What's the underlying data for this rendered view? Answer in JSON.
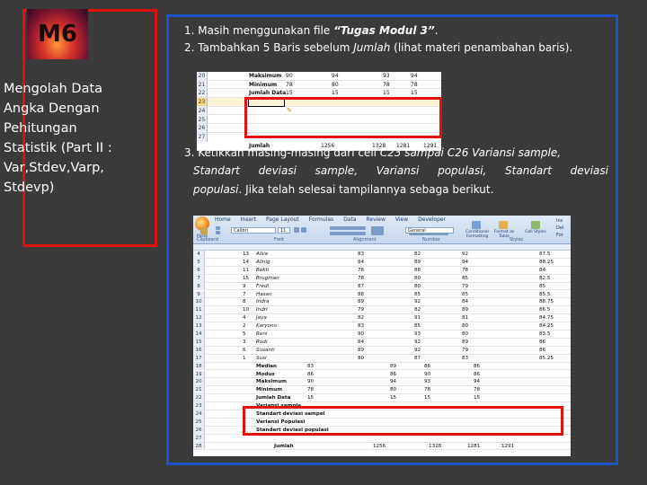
{
  "left": {
    "badge": "M6",
    "title_lines": [
      "Mengolah Data",
      "Angka Dengan",
      "Pehitungan",
      "Statistik (Part II :",
      "Var,Stdev,Varp,",
      "Stdevp)"
    ]
  },
  "steps": {
    "s1_num": "1.",
    "s1_a": "Masih menggunakan file ",
    "s1_b": "“Tugas Modul 3”",
    "s1_c": ".",
    "s2_num": "2.",
    "s2_a": "Tambahkan 5 Baris sebelum ",
    "s2_b": "Jumlah",
    "s2_c": " (lihat materi penambahan baris).",
    "s3_num": "3.",
    "s3_a": "Ketikkan masing-masing dari cell ",
    "s3_b": "C23 sampai C26",
    "s3_c": " Variansi sample,",
    "s3_line2": "Standart deviasi sample, Variansi populasi, Standart deviasi",
    "s3_line3a": "populasi",
    "s3_line3b": ". Jika telah selesai tampilannya sebaga berikut."
  },
  "sheet1": {
    "rows": [
      {
        "n": "20",
        "label": "Maksimum",
        "v": [
          "90",
          "94",
          "93",
          "94"
        ]
      },
      {
        "n": "21",
        "label": "Minimum",
        "v": [
          "78",
          "80",
          "78",
          "78"
        ]
      },
      {
        "n": "22",
        "label": "Jumlah Data",
        "v": [
          "15",
          "15",
          "15",
          "15"
        ]
      },
      {
        "n": "23",
        "label": "",
        "v": [
          "",
          "",
          "",
          ""
        ]
      },
      {
        "n": "24",
        "label": "",
        "v": [
          "",
          "",
          "",
          ""
        ]
      },
      {
        "n": "25",
        "label": "",
        "v": [
          "",
          "",
          "",
          ""
        ]
      },
      {
        "n": "26",
        "label": "",
        "v": [
          "",
          "",
          "",
          ""
        ]
      },
      {
        "n": "27",
        "label": "Jumlah",
        "v": [
          "1256",
          "1328",
          "1281",
          "1291"
        ]
      }
    ]
  },
  "excel": {
    "tabs": [
      "Home",
      "Insert",
      "Page Layout",
      "Formulas",
      "Data",
      "Review",
      "View",
      "Developer"
    ],
    "font": "Calibri",
    "size": "11",
    "number_format": "General",
    "groups": [
      "Clipboard",
      "Font",
      "Alignment",
      "Number",
      "Styles"
    ],
    "paste": "Paste",
    "style_btns": [
      "Conditional Formatting",
      "Format as Table",
      "Cell Styles"
    ],
    "side": [
      "Ins",
      "Del",
      "For"
    ],
    "students": [
      {
        "n": "4",
        "no": "13",
        "name": "Alice",
        "a": "83",
        "b": "82",
        "c": "92",
        "d": "87.5"
      },
      {
        "n": "5",
        "no": "14",
        "name": "Alinig",
        "a": "84",
        "b": "89",
        "c": "94",
        "d": "88.25"
      },
      {
        "n": "6",
        "no": "11",
        "name": "Bekti",
        "a": "78",
        "b": "88",
        "c": "78",
        "d": "84"
      },
      {
        "n": "7",
        "no": "15",
        "name": "Brugman",
        "a": "78",
        "b": "80",
        "c": "85",
        "d": "82.5"
      },
      {
        "n": "8",
        "no": "9",
        "name": "Fredi",
        "a": "87",
        "b": "80",
        "c": "79",
        "d": "85"
      },
      {
        "n": "9",
        "no": "7",
        "name": "Hasan",
        "a": "88",
        "b": "85",
        "c": "85",
        "d": "85.5"
      },
      {
        "n": "10",
        "no": "8",
        "name": "Indra",
        "a": "89",
        "b": "92",
        "c": "84",
        "d": "88.75"
      },
      {
        "n": "11",
        "no": "10",
        "name": "Indri",
        "a": "79",
        "b": "82",
        "c": "89",
        "d": "86.5"
      },
      {
        "n": "12",
        "no": "4",
        "name": "Jaya",
        "a": "82",
        "b": "91",
        "c": "81",
        "d": "84.75"
      },
      {
        "n": "13",
        "no": "2",
        "name": "Karyono",
        "a": "83",
        "b": "85",
        "c": "80",
        "d": "84.25"
      },
      {
        "n": "14",
        "no": "5",
        "name": "Reni",
        "a": "90",
        "b": "93",
        "c": "80",
        "d": "83.5"
      },
      {
        "n": "15",
        "no": "3",
        "name": "Rudi",
        "a": "84",
        "b": "92",
        "c": "89",
        "d": "86"
      },
      {
        "n": "16",
        "no": "6",
        "name": "Susanti",
        "a": "89",
        "b": "92",
        "c": "79",
        "d": "86"
      },
      {
        "n": "17",
        "no": "1",
        "name": "Susi",
        "a": "80",
        "b": "87",
        "c": "83",
        "d": "85.25"
      }
    ],
    "stats": [
      {
        "n": "18",
        "label": "Median",
        "v": [
          "83",
          "89",
          "86",
          "86"
        ]
      },
      {
        "n": "19",
        "label": "Modus",
        "v": [
          "86",
          "86",
          "90",
          "86"
        ]
      },
      {
        "n": "20",
        "label": "Maksimum",
        "v": [
          "90",
          "94",
          "93",
          "94"
        ]
      },
      {
        "n": "21",
        "label": "Minimum",
        "v": [
          "78",
          "80",
          "78",
          "78"
        ]
      },
      {
        "n": "22",
        "label": "Jumlah Data",
        "v": [
          "15",
          "15",
          "15",
          "15"
        ]
      }
    ],
    "new_rows": [
      {
        "n": "23",
        "label": "Variansi sample"
      },
      {
        "n": "24",
        "label": "Standart deviasi sampel"
      },
      {
        "n": "25",
        "label": "Variansi Populasi"
      },
      {
        "n": "26",
        "label": "Standart deviasi populasi"
      }
    ],
    "blank_rows": [
      "27"
    ],
    "total": {
      "n": "28",
      "label": "Jumlah",
      "v": [
        "1256",
        "1328",
        "1281",
        "1291"
      ]
    }
  }
}
